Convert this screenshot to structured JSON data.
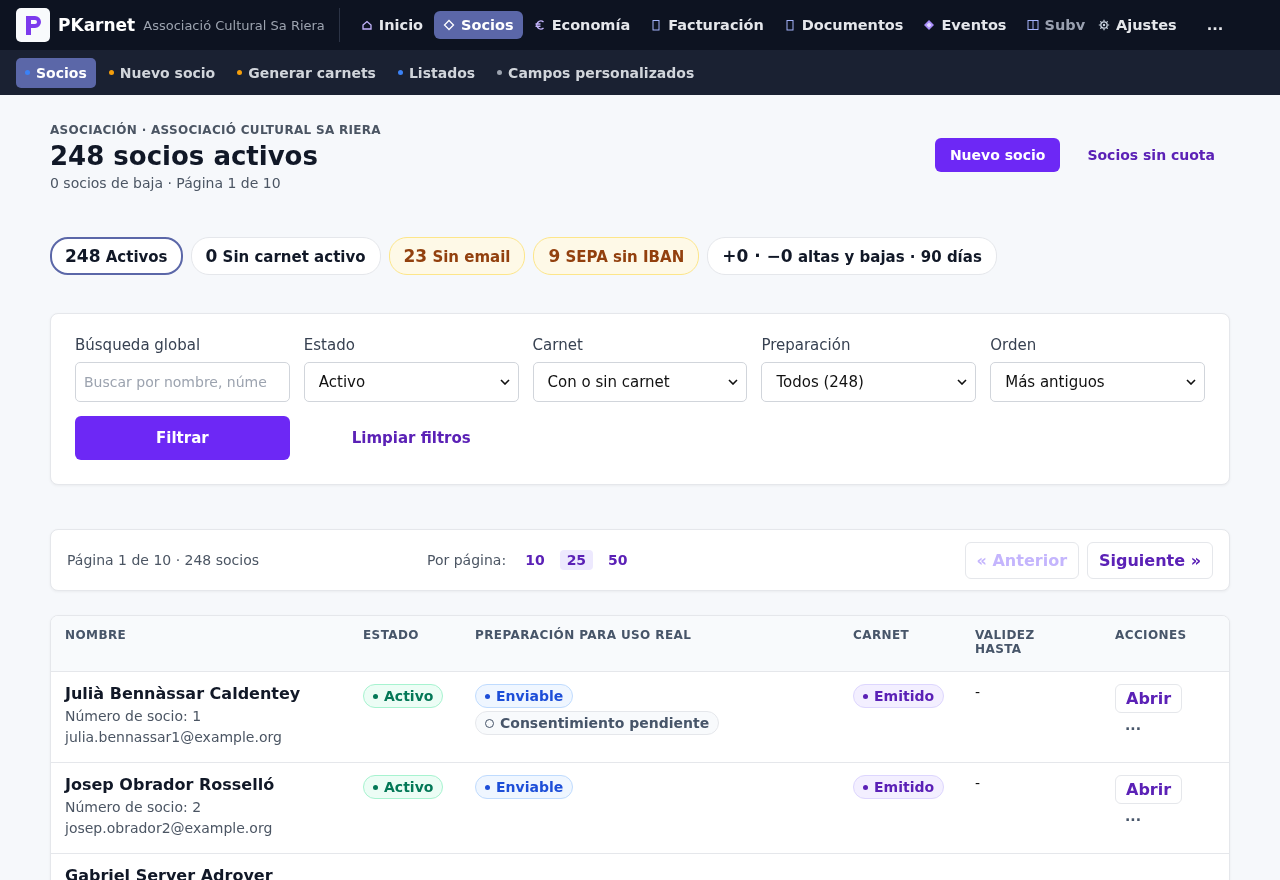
{
  "brand": {
    "name": "PKarnet",
    "org": "Associació Cultural Sa Riera"
  },
  "nav": [
    {
      "label": "Inicio",
      "selected": false
    },
    {
      "label": "Socios",
      "selected": true
    },
    {
      "label": "Economía",
      "selected": false
    },
    {
      "label": "Facturación",
      "selected": false
    },
    {
      "label": "Documentos",
      "selected": false
    },
    {
      "label": "Eventos",
      "selected": false
    },
    {
      "label": "Subv",
      "selected": false
    },
    {
      "label": "Ajustes",
      "selected": false
    }
  ],
  "nav_more": "...",
  "subnav": [
    {
      "label": "Socios",
      "selected": true,
      "color": "#3b82f6"
    },
    {
      "label": "Nuevo socio",
      "selected": false,
      "color": "#f59e0b"
    },
    {
      "label": "Generar carnets",
      "selected": false,
      "color": "#f59e0b"
    },
    {
      "label": "Listados",
      "selected": false,
      "color": "#3b82f6"
    },
    {
      "label": "Campos personalizados",
      "selected": false,
      "color": "#9ca3af"
    }
  ],
  "header": {
    "eyebrow": "ASOCIACIÓN · ASSOCIACIÓ CULTURAL SA RIERA",
    "title": "248 socios activos",
    "subtitle": "0 socios de baja · Página 1 de 10",
    "primary_button": "Nuevo socio",
    "secondary_button": "Socios sin cuota"
  },
  "chips": [
    {
      "count": "248",
      "label": "Activos",
      "kind": "neutral",
      "selected": true
    },
    {
      "count": "0",
      "label": "Sin carnet activo",
      "kind": "neutral",
      "selected": false
    },
    {
      "count": "23",
      "label": "Sin email",
      "kind": "warning",
      "selected": false
    },
    {
      "count": "9",
      "label": "SEPA sin IBAN",
      "kind": "warning",
      "selected": false
    },
    {
      "count": "+0 · −0",
      "label": "altas y bajas · 90 días",
      "kind": "neutral",
      "selected": false
    }
  ],
  "filters": {
    "fields": [
      {
        "label": "Búsqueda global",
        "kind": "text",
        "placeholder": "Buscar por nombre, núme"
      },
      {
        "label": "Estado",
        "kind": "select",
        "value": "Activo"
      },
      {
        "label": "Carnet",
        "kind": "select",
        "value": "Con o sin carnet"
      },
      {
        "label": "Preparación",
        "kind": "select",
        "value": "Todos (248)"
      },
      {
        "label": "Orden",
        "kind": "select",
        "value": "Más antiguos"
      }
    ],
    "submit": "Filtrar",
    "clear": "Limpiar filtros"
  },
  "pagination": {
    "summary": "Página 1 de 10 · 248 socios",
    "per_page_label": "Por página:",
    "per_page": [
      {
        "label": "10",
        "selected": false
      },
      {
        "label": "25",
        "selected": true
      },
      {
        "label": "50",
        "selected": false
      }
    ],
    "prev": {
      "label": "« Anterior",
      "disabled": true
    },
    "next": {
      "label": "Siguiente »",
      "disabled": false
    }
  },
  "table": {
    "columns": [
      "NOMBRE",
      "ESTADO",
      "PREPARACIÓN PARA USO REAL",
      "CARNET",
      "VALIDEZ HASTA",
      "ACCIONES"
    ],
    "rows": [
      {
        "name": "Julià Bennàssar Caldentey",
        "number": "Número de socio: 1",
        "email": "julia.bennassar1@example.org",
        "status": "Activo",
        "readiness": [
          {
            "label": "Enviable",
            "kind": "ok"
          },
          {
            "label": "Consentimiento pendiente",
            "kind": "pending"
          }
        ],
        "card": "Emitido",
        "valid_until": "-",
        "action": "Abrir",
        "more": "..."
      },
      {
        "name": "Josep Obrador Rosselló",
        "number": "Número de socio: 2",
        "email": "josep.obrador2@example.org",
        "status": "Activo",
        "readiness": [
          {
            "label": "Enviable",
            "kind": "ok"
          }
        ],
        "card": "Emitido",
        "valid_until": "-",
        "action": "Abrir",
        "more": "..."
      },
      {
        "name": "Gabriel Server Adrover"
      }
    ]
  }
}
